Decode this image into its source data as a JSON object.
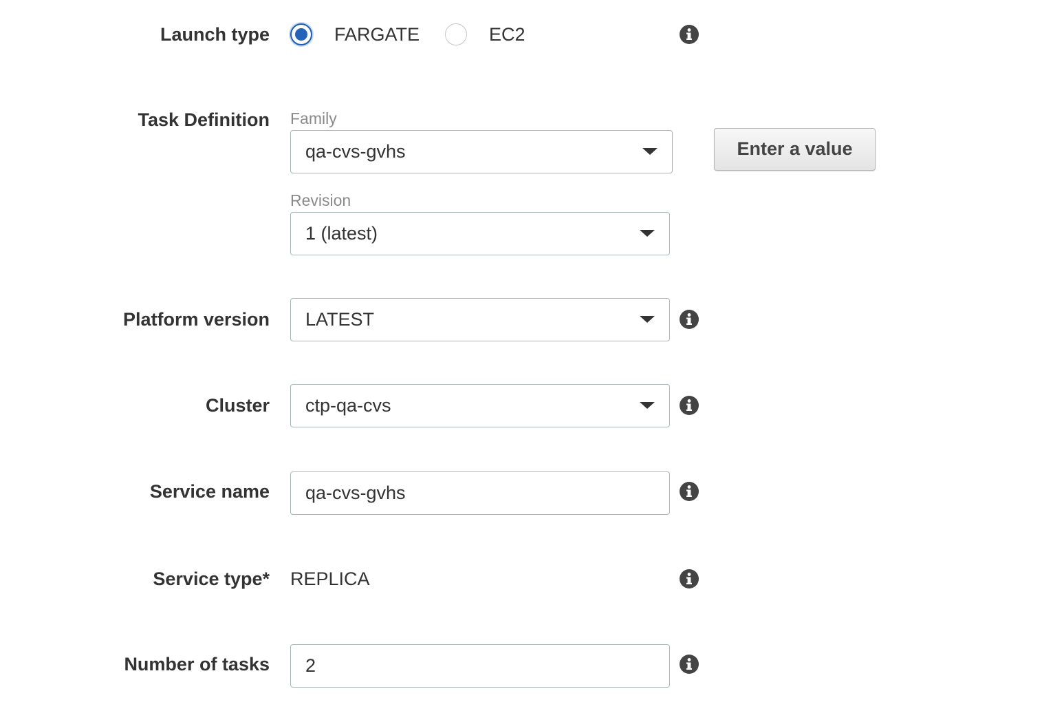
{
  "launch_type": {
    "label": "Launch type",
    "options": [
      {
        "label": "FARGATE",
        "selected": true
      },
      {
        "label": "EC2",
        "selected": false
      }
    ]
  },
  "task_definition": {
    "label": "Task Definition",
    "family_label": "Family",
    "family_value": "qa-cvs-gvhs",
    "revision_label": "Revision",
    "revision_value": "1 (latest)",
    "enter_value_button": "Enter a value"
  },
  "platform_version": {
    "label": "Platform version",
    "value": "LATEST"
  },
  "cluster": {
    "label": "Cluster",
    "value": "ctp-qa-cvs"
  },
  "service_name": {
    "label": "Service name",
    "value": "qa-cvs-gvhs"
  },
  "service_type": {
    "label": "Service type*",
    "value": "REPLICA"
  },
  "number_of_tasks": {
    "label": "Number of tasks",
    "value": "2"
  },
  "colors": {
    "radio_selected": "#2563b8",
    "text": "#333333",
    "border": "#aab7b8",
    "info_icon": "#444444"
  }
}
